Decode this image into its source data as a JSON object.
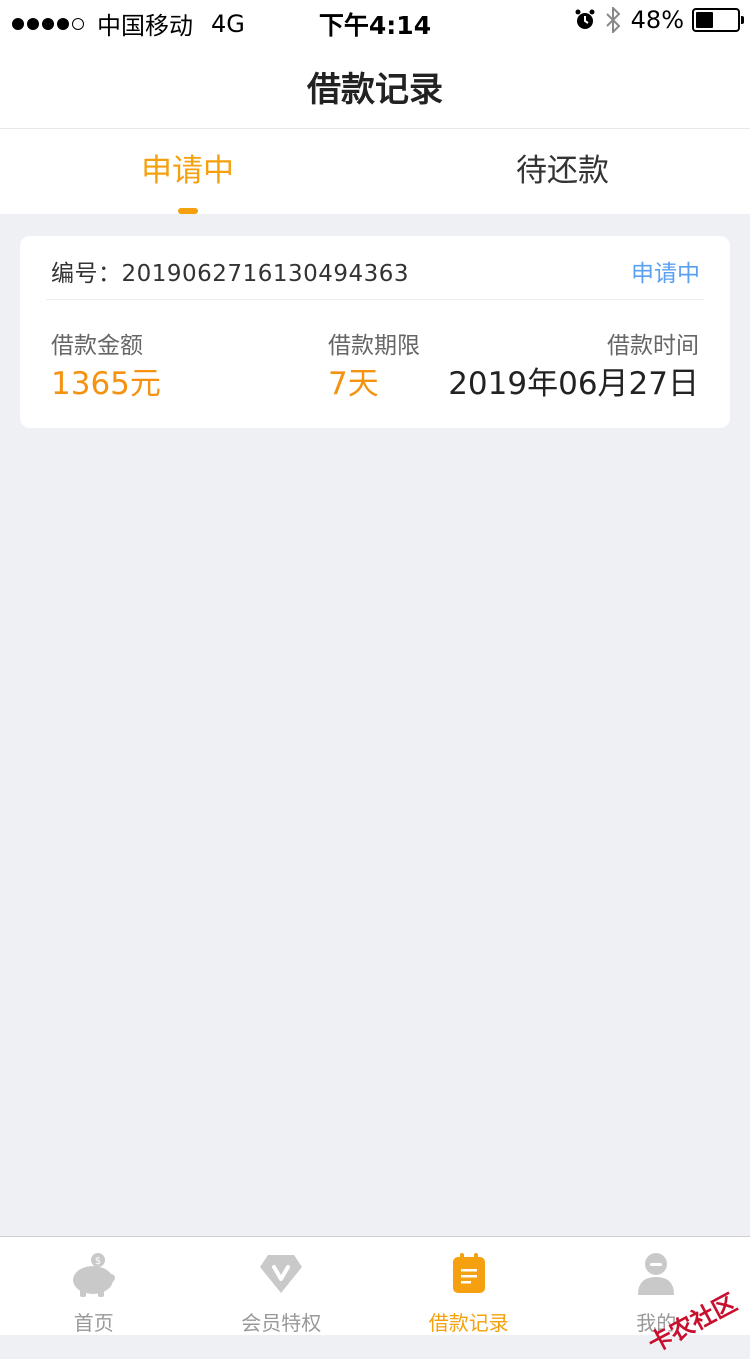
{
  "status_bar": {
    "carrier": "中国移动",
    "network": "4G",
    "time": "下午4:14",
    "battery": "48%",
    "battery_level": 0.48
  },
  "nav": {
    "title": "借款记录"
  },
  "tabs": [
    {
      "label": "申请中",
      "active": true
    },
    {
      "label": "待还款",
      "active": false
    }
  ],
  "record": {
    "order_label": "编号：2019062716130494363",
    "status": "申请中",
    "amount_label": "借款金额",
    "amount_value": "1365元",
    "term_label": "借款期限",
    "term_value": "7天",
    "time_label": "借款时间",
    "time_value": "2019年06月27日"
  },
  "tabbar": [
    {
      "label": "首页",
      "icon": "piggy-bank-icon"
    },
    {
      "label": "会员特权",
      "icon": "diamond-icon"
    },
    {
      "label": "借款记录",
      "icon": "notepad-icon",
      "active": true
    },
    {
      "label": "我的",
      "icon": "user-icon"
    }
  ],
  "watermark": "卡农社区",
  "colors": {
    "accent": "#F5A00F",
    "amount": "#F59311",
    "status_blue": "#5AA0F0",
    "background": "#EFF0F4"
  }
}
